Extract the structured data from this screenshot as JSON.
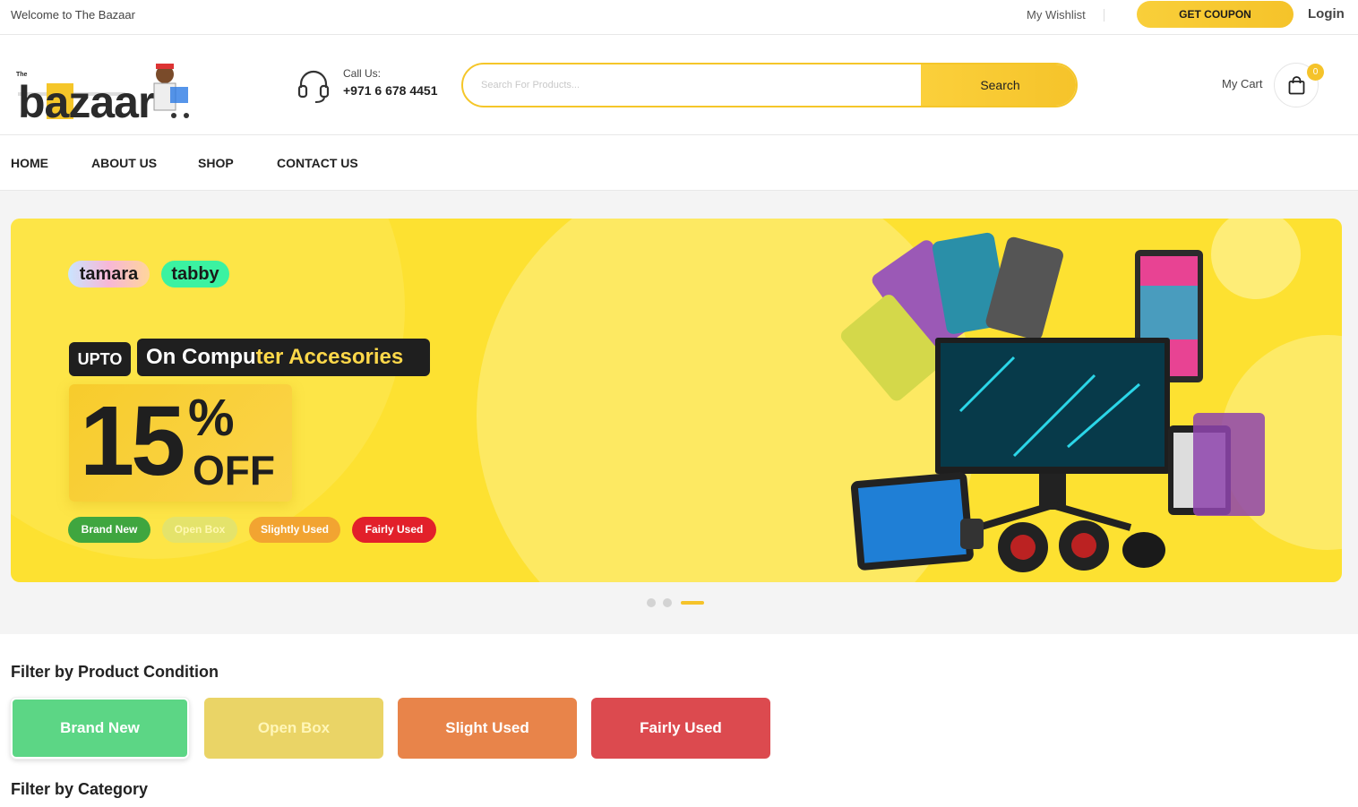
{
  "topbar": {
    "welcome": "Welcome to The Bazaar",
    "wishlist": "My Wishlist",
    "coupon": "GET COUPON",
    "login": "Login"
  },
  "header": {
    "logo_text": "bazaar",
    "logo_small": "The",
    "call_label": "Call Us:",
    "call_phone": "+971 6 678 4451",
    "search_placeholder": "Search For Products...",
    "search_button": "Search",
    "cart_label": "My Cart",
    "cart_count": "0"
  },
  "nav": {
    "items": [
      "HOME",
      "ABOUT US",
      "SHOP",
      "CONTACT US"
    ]
  },
  "banner": {
    "payment_logos": [
      "tamara",
      "tabby"
    ],
    "upto": "UPTO",
    "headline_part1": "On Compu",
    "headline_part2": "ter Accesories",
    "off_number": "15",
    "off_percent": "%",
    "off_word": "OFF",
    "conditions": [
      {
        "label": "Brand New",
        "color": "#3fa63f"
      },
      {
        "label": "Open Box",
        "color": "#e4e36b"
      },
      {
        "label": "Slightly Used",
        "color": "#f2a431"
      },
      {
        "label": "Fairly Used",
        "color": "#e2202a"
      }
    ],
    "slide_count": 3,
    "active_slide": 3
  },
  "filters": {
    "condition_title": "Filter by Product Condition",
    "conditions": [
      {
        "label": "Brand New",
        "color": "#5cd685"
      },
      {
        "label": "Open Box",
        "color": "#ead466"
      },
      {
        "label": "Slight Used",
        "color": "#e8844a"
      },
      {
        "label": "Fairly Used",
        "color": "#dc4a4f"
      }
    ],
    "category_title": "Filter by Category"
  },
  "colors": {
    "accent": "#f5c32a",
    "banner_bg": "#fde131"
  }
}
